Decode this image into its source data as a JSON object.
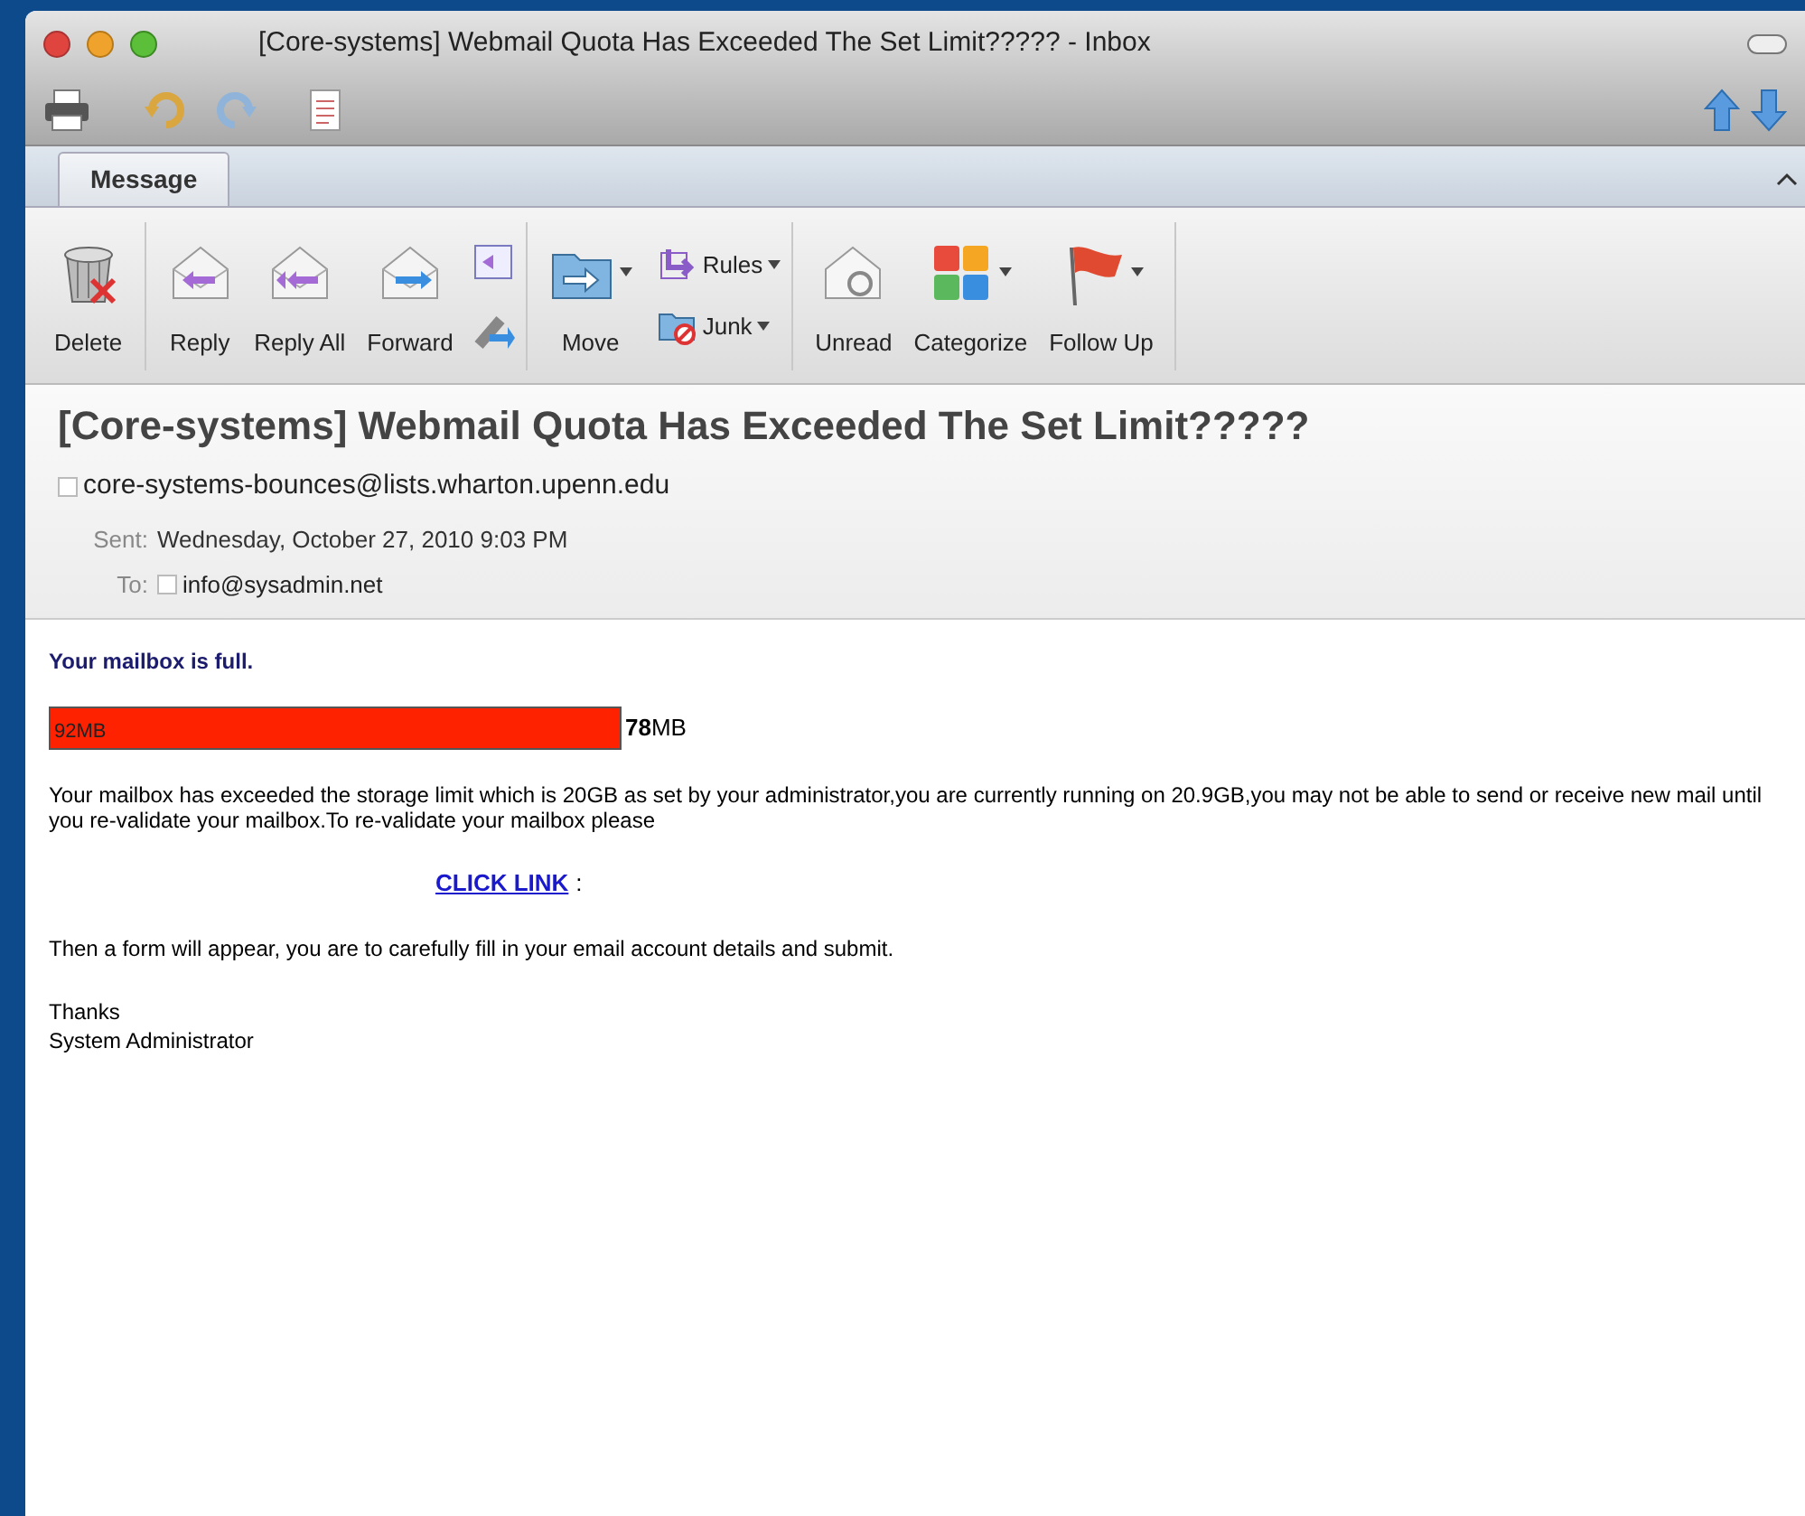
{
  "window": {
    "title": "[Core-systems] Webmail Quota Has Exceeded The Set Limit????? - Inbox"
  },
  "tabs": [
    {
      "label": "Message",
      "selected": true
    }
  ],
  "ribbon": [
    {
      "label": "Delete",
      "dropdown": false
    },
    {
      "label": "Reply",
      "dropdown": false
    },
    {
      "label": "Reply All",
      "dropdown": false
    },
    {
      "label": "Forward",
      "dropdown": false
    },
    {
      "label": "Move",
      "dropdown": true
    },
    {
      "label": "Rules",
      "dropdown": true
    },
    {
      "label": "Junk",
      "dropdown": true
    },
    {
      "label": "Unread",
      "dropdown": false
    },
    {
      "label": "Categorize",
      "dropdown": true
    },
    {
      "label": "Follow Up",
      "dropdown": true
    }
  ],
  "message": {
    "subject": "[Core-systems] Webmail Quota Has Exceeded The Set Limit?????",
    "from": "core-systems-bounces@lists.wharton.upenn.edu",
    "sent_label": "Sent:",
    "sent": "Wednesday, October 27, 2010 9:03 PM",
    "to_label": "To:",
    "to": "info@sysadmin.net"
  },
  "body": {
    "heading": "Your mailbox is full.",
    "quota": {
      "used": "92MB",
      "level": 1,
      "remaining": "**78**MB"
    },
    "paragraph": "Your mailbox has exceeded the storage limit which is 20GB as set by your administrator,you are currently running on 20.9GB,you may not be able to send or receive new mail until you re-validate your mailbox.To re-validate your mailbox please",
    "link": "CLICK LINK",
    "link_suffix": ":",
    "instruction": "Then a form will appear, you are to carefully fill in your email account details and submit.",
    "signoff": [
      "Thanks",
      "System Administrator"
    ]
  }
}
